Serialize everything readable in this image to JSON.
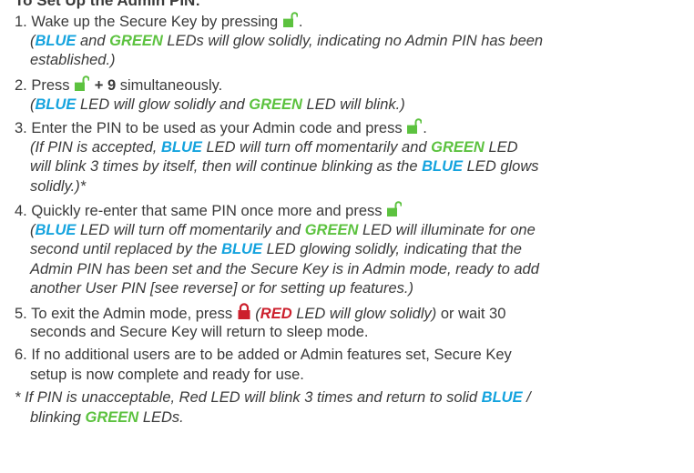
{
  "title": "To Set Up the Admin PIN:",
  "colors": {
    "text": "#3a3a3a",
    "blue": "#14a3de",
    "green": "#5cc23f",
    "red": "#cc1f2c"
  },
  "icons": {
    "unlock": "unlock-icon",
    "lock": "lock-icon"
  },
  "steps": [
    {
      "num": "1.",
      "lines": [
        {
          "t1": "Wake up the Secure Key by pressing",
          "t2": "."
        },
        {
          "p1": "(",
          "blue": "BLUE",
          "and": " and ",
          "green": "GREEN",
          "rest": " LEDs will glow solidly, indicating no Admin PIN has been"
        },
        {
          "text": "established.)"
        }
      ]
    },
    {
      "num": "2.",
      "lines": [
        {
          "t1": "Press",
          "plus": "+ 9",
          "t2": " simultaneously."
        },
        {
          "p1": "(",
          "blue": "BLUE",
          "mid": " LED will glow solidly and ",
          "green": "GREEN",
          "rest": " LED will blink.)"
        }
      ]
    },
    {
      "num": "3.",
      "lines": [
        {
          "t1": "Enter the PIN to be used as your Admin code and press",
          "t2": "."
        },
        {
          "p1": "(If PIN is accepted, ",
          "blue": "BLUE",
          "mid": " LED will turn off momentarily and ",
          "green": "GREEN",
          "rest": " LED"
        },
        {
          "p1": "will blink 3 times by itself, then will continue blinking as the ",
          "blue": "BLUE",
          "rest": " LED glows"
        },
        {
          "text": "solidly.)*"
        }
      ]
    },
    {
      "num": "4.",
      "lines": [
        {
          "t1": "Quickly re-enter that same PIN once more and press"
        },
        {
          "p1": "(",
          "blue": "BLUE",
          "mid": " LED will turn off momentarily and ",
          "green": "GREEN",
          "rest": " LED will illuminate for one"
        },
        {
          "p1": "second until replaced by the ",
          "blue": "BLUE",
          "rest": " LED glowing solidly, indicating that the"
        },
        {
          "text": "Admin PIN has been set and the Secure Key is in Admin mode, ready to add"
        },
        {
          "text2": "another User PIN [see reverse] or for setting up features.)"
        }
      ]
    },
    {
      "num": "5.",
      "lines": [
        {
          "t1": "To exit the Admin mode, press",
          "p1": "(",
          "red": "RED",
          "mid": " LED will glow solidly)",
          "t2": " or wait 30"
        },
        {
          "text": "seconds and Secure Key will return to sleep mode."
        }
      ]
    },
    {
      "num": "6.",
      "lines": [
        {
          "t1": "If no additional users are to be added or Admin features set, Secure Key"
        },
        {
          "text": "setup is now complete and ready for use."
        }
      ]
    }
  ],
  "footnote": {
    "star": "*",
    "t1": " If PIN is unacceptable, Red LED will blink 3 times and return to solid ",
    "blue": "BLUE",
    "slash": " /",
    "t2": "blinking ",
    "green": "GREEN",
    "t3": " LEDs."
  }
}
